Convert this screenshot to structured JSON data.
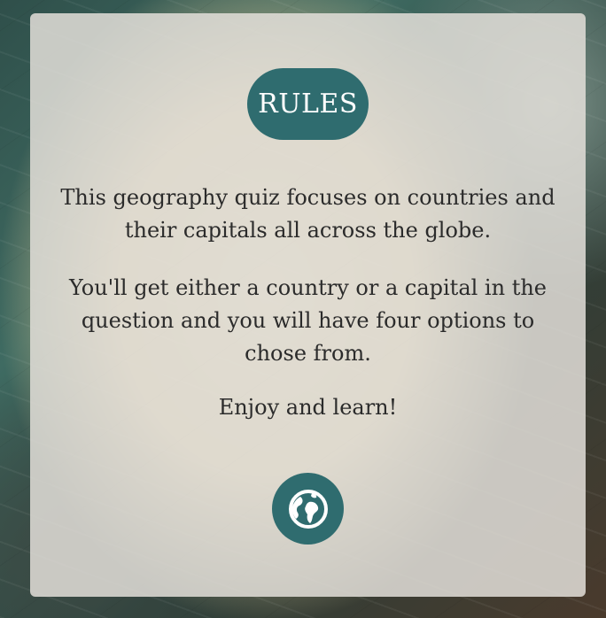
{
  "rules": {
    "title": "RULES",
    "paragraphs": [
      "This geography quiz focuses on countries and their capitals all across the globe.",
      "You'll get either a country or a capital in the question and you will have four options to chose from.",
      "Enjoy and learn!"
    ],
    "start_icon": "globe-icon"
  },
  "colors": {
    "accent": "#2f6c6f",
    "card_bg": "#e2ded8",
    "text": "#2b2b2b"
  }
}
